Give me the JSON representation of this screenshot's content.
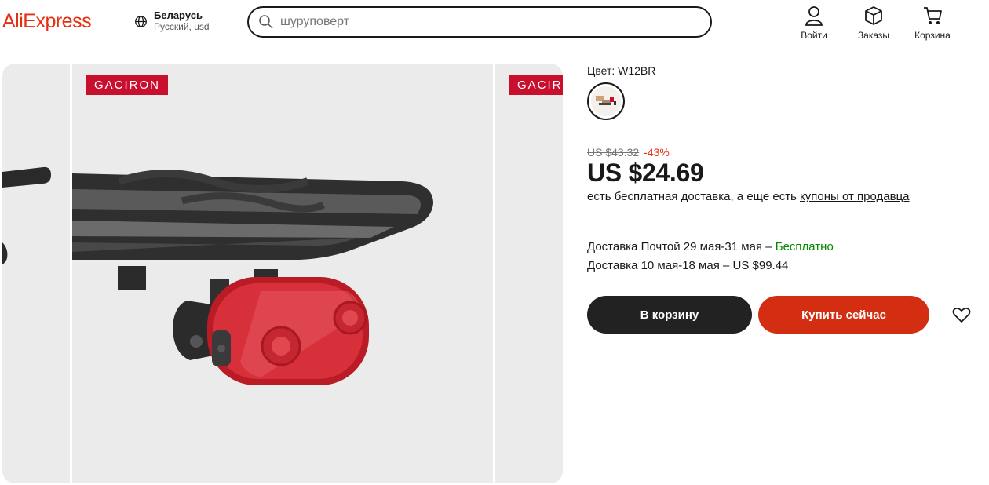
{
  "header": {
    "logo": "AliExpress",
    "region": {
      "country": "Беларусь",
      "lang_currency": "Русский, usd"
    },
    "search": {
      "placeholder": "шуруповерт",
      "value": ""
    },
    "nav": {
      "login": "Войти",
      "orders": "Заказы",
      "cart": "Корзина"
    }
  },
  "gallery": {
    "brand": "GACIRON"
  },
  "product": {
    "color_label": "Цвет: W12BR",
    "old_price": "US $43.32",
    "discount": "-43%",
    "price": "US $24.69",
    "shipping_note": "есть бесплатная доставка, а еще есть ",
    "coupons_link": "купоны от продавца",
    "delivery1_prefix": "Доставка Почтой 29 мая-31 мая – ",
    "delivery1_free": "Бесплатно",
    "delivery2": "Доставка 10 мая-18 мая – US $99.44",
    "add_to_cart": "В корзину",
    "buy_now": "Купить сейчас"
  },
  "colors": {
    "brand": "#e52f12",
    "buy_button": "#d42e12",
    "cart_button": "#222222",
    "free": "#008a00"
  }
}
